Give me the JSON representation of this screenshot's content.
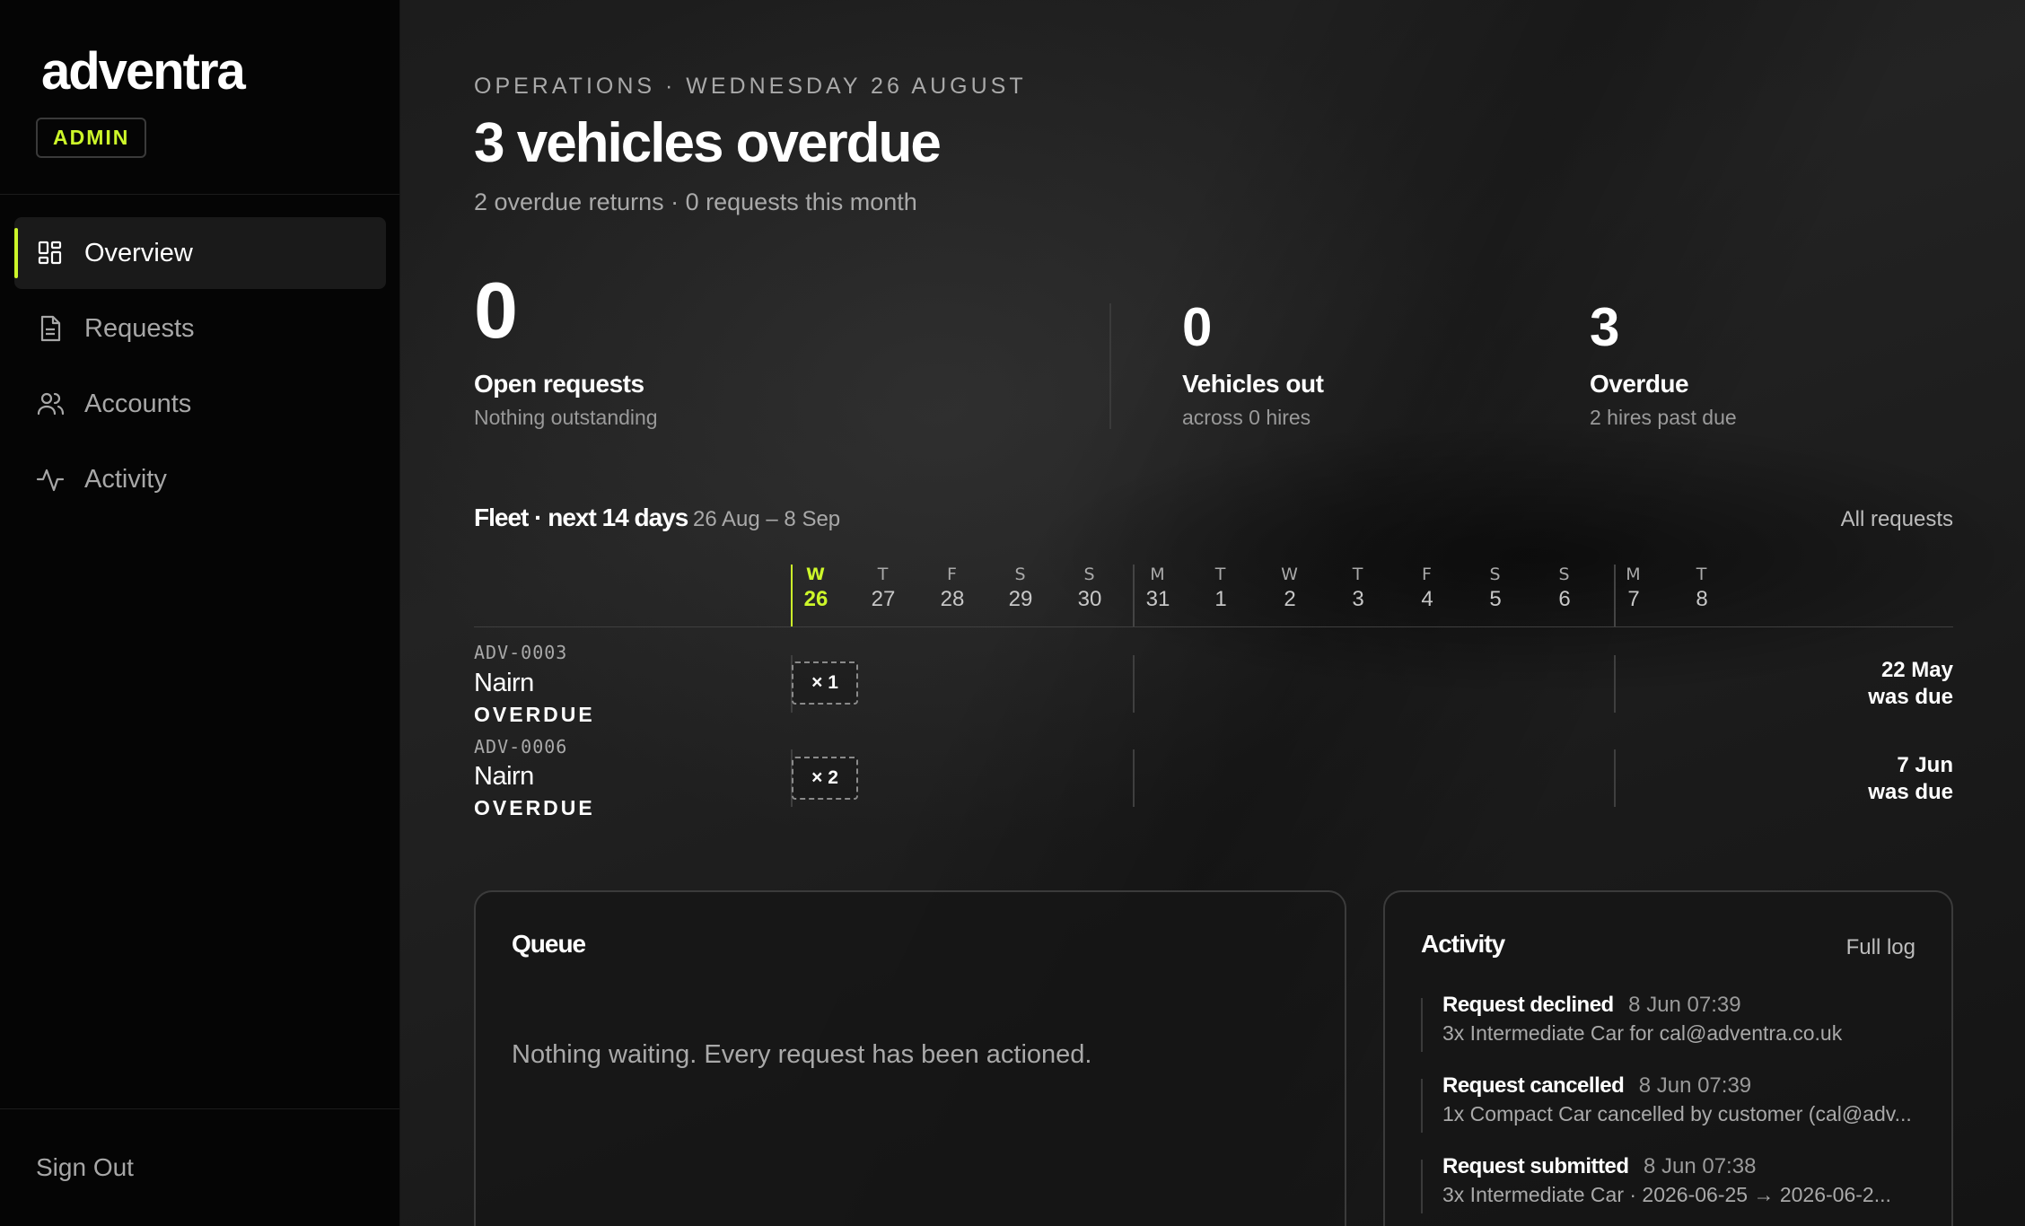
{
  "brand": {
    "name": "adventra",
    "role_badge": "ADMIN"
  },
  "nav": {
    "items": [
      {
        "label": "Overview",
        "icon": "grid-icon",
        "active": true
      },
      {
        "label": "Requests",
        "icon": "document-icon",
        "active": false
      },
      {
        "label": "Accounts",
        "icon": "users-icon",
        "active": false
      },
      {
        "label": "Activity",
        "icon": "pulse-icon",
        "active": false
      }
    ],
    "sign_out": "Sign Out"
  },
  "header": {
    "eyebrow": "OPERATIONS · WEDNESDAY 26 AUGUST",
    "headline": "3 vehicles overdue",
    "subline": "2 overdue returns · 0 requests this month"
  },
  "stats": [
    {
      "value": "0",
      "label": "Open requests",
      "sub": "Nothing outstanding"
    },
    {
      "value": "0",
      "label": "Vehicles out",
      "sub": "across 0 hires"
    },
    {
      "value": "3",
      "label": "Overdue",
      "sub": "2 hires past due"
    }
  ],
  "fleet": {
    "title": "Fleet · next 14 days",
    "range": "26 Aug – 8 Sep",
    "all_requests_link": "All requests",
    "days": [
      {
        "letter": "W",
        "num": "26",
        "today": true
      },
      {
        "letter": "T",
        "num": "27"
      },
      {
        "letter": "F",
        "num": "28"
      },
      {
        "letter": "S",
        "num": "29"
      },
      {
        "letter": "S",
        "num": "30"
      },
      {
        "letter": "M",
        "num": "31"
      },
      {
        "letter": "T",
        "num": "1"
      },
      {
        "letter": "W",
        "num": "2"
      },
      {
        "letter": "T",
        "num": "3"
      },
      {
        "letter": "F",
        "num": "4"
      },
      {
        "letter": "S",
        "num": "5"
      },
      {
        "letter": "S",
        "num": "6"
      },
      {
        "letter": "M",
        "num": "7"
      },
      {
        "letter": "T",
        "num": "8"
      }
    ],
    "rows": [
      {
        "id": "ADV-0003",
        "name": "Nairn",
        "status": "OVERDUE",
        "chip": "× 1",
        "due_date": "22 May",
        "due_note": "was due"
      },
      {
        "id": "ADV-0006",
        "name": "Nairn",
        "status": "OVERDUE",
        "chip": "× 2",
        "due_date": "7 Jun",
        "due_note": "was due"
      }
    ]
  },
  "queue": {
    "title": "Queue",
    "empty_text": "Nothing waiting. Every request has been actioned."
  },
  "activity": {
    "title": "Activity",
    "link": "Full log",
    "items": [
      {
        "title": "Request declined",
        "time": "8 Jun 07:39",
        "detail": "3x Intermediate Car for cal@adventra.co.uk"
      },
      {
        "title": "Request cancelled",
        "time": "8 Jun 07:39",
        "detail": "1x Compact Car cancelled by customer (cal@adv..."
      },
      {
        "title": "Request submitted",
        "time": "8 Jun 07:38",
        "detail": "3x Intermediate Car · 2026-06-25 → 2026-06-2..."
      }
    ]
  },
  "colors": {
    "accent": "#cdf72a",
    "sidebar_bg": "#050505",
    "text_muted": "#a9a9a9"
  }
}
